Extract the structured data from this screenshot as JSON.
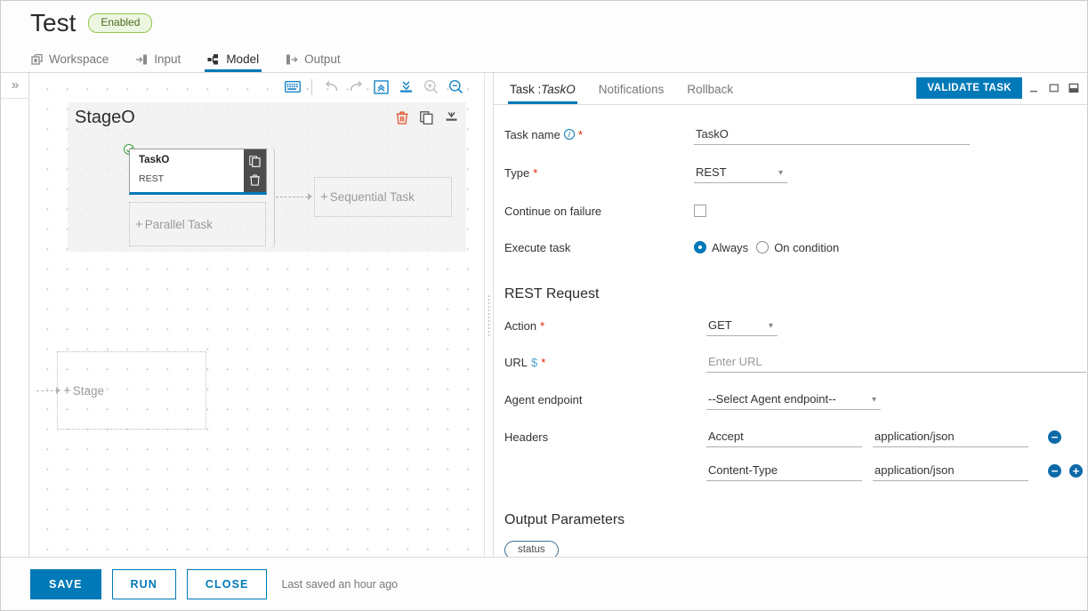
{
  "header": {
    "title": "Test",
    "status_badge": "Enabled",
    "tabs": [
      {
        "label": "Workspace",
        "icon": "workspace-icon",
        "active": false
      },
      {
        "label": "Input",
        "icon": "input-icon",
        "active": false
      },
      {
        "label": "Model",
        "icon": "model-icon",
        "active": true
      },
      {
        "label": "Output",
        "icon": "output-icon",
        "active": false
      }
    ]
  },
  "left_rail": {
    "toggle_icon": "chevron-double-right-icon"
  },
  "canvas": {
    "toolbar": [
      {
        "name": "keyboard-icon",
        "label": "keyboard"
      },
      {
        "name": "undo-icon",
        "label": "undo"
      },
      {
        "name": "redo-icon",
        "label": "redo"
      },
      {
        "name": "collapse-all-icon",
        "label": "collapse all"
      },
      {
        "name": "expand-all-icon",
        "label": "expand all"
      },
      {
        "name": "zoom-in-icon",
        "label": "zoom in"
      },
      {
        "name": "zoom-out-icon",
        "label": "zoom out"
      }
    ],
    "stage": {
      "title": "StageO",
      "actions": [
        {
          "name": "delete-stage-icon",
          "label": "delete"
        },
        {
          "name": "copy-stage-icon",
          "label": "copy"
        },
        {
          "name": "export-stage-icon",
          "label": "export"
        }
      ],
      "task": {
        "name": "TaskO",
        "type": "REST",
        "actions": [
          {
            "name": "copy-task-icon",
            "label": "copy"
          },
          {
            "name": "delete-task-icon",
            "label": "delete"
          }
        ]
      },
      "add_parallel_task": "Parallel Task",
      "add_sequential_task": "Sequential Task"
    },
    "add_stage": "Stage"
  },
  "right_panel": {
    "tabs": [
      {
        "label": "Task :",
        "value": "TaskO",
        "active": true
      },
      {
        "label": "Notifications",
        "value": "",
        "active": false
      },
      {
        "label": "Rollback",
        "value": "",
        "active": false
      }
    ],
    "validate_button": "VALIDATE TASK",
    "window_controls": [
      {
        "name": "minimize-icon",
        "label": "minimize"
      },
      {
        "name": "maximize-icon",
        "label": "maximize"
      },
      {
        "name": "restore-icon",
        "label": "restore"
      }
    ],
    "fields": {
      "task_name_label": "Task name",
      "task_name_value": "TaskO",
      "type_label": "Type",
      "type_value": "REST",
      "type_options": [
        "REST"
      ],
      "continue_on_failure_label": "Continue on failure",
      "continue_on_failure_checked": false,
      "execute_task_label": "Execute task",
      "execute_task_options": [
        "Always",
        "On condition"
      ],
      "execute_task_selected": "Always"
    },
    "rest_request": {
      "section_title": "REST Request",
      "action_label": "Action",
      "action_value": "GET",
      "action_options": [
        "GET"
      ],
      "url_label": "URL",
      "url_value": "",
      "url_placeholder": "Enter URL",
      "agent_endpoint_label": "Agent endpoint",
      "agent_endpoint_value": "--Select Agent endpoint--",
      "agent_endpoint_options": [
        "--Select Agent endpoint--"
      ],
      "headers_label": "Headers",
      "headers": [
        {
          "key": "Accept",
          "value": "application/json",
          "can_add": false
        },
        {
          "key": "Content-Type",
          "value": "application/json",
          "can_add": true
        }
      ]
    },
    "output_parameters": {
      "section_title": "Output Parameters",
      "chips": [
        "status"
      ]
    }
  },
  "footer": {
    "save": "SAVE",
    "run": "RUN",
    "close": "CLOSE",
    "saved_text": "Last saved an hour ago"
  },
  "colors": {
    "accent": "#0079b8",
    "danger": "#e02200",
    "badge_border": "#8fc94e",
    "badge_bg": "#edf6e1"
  }
}
